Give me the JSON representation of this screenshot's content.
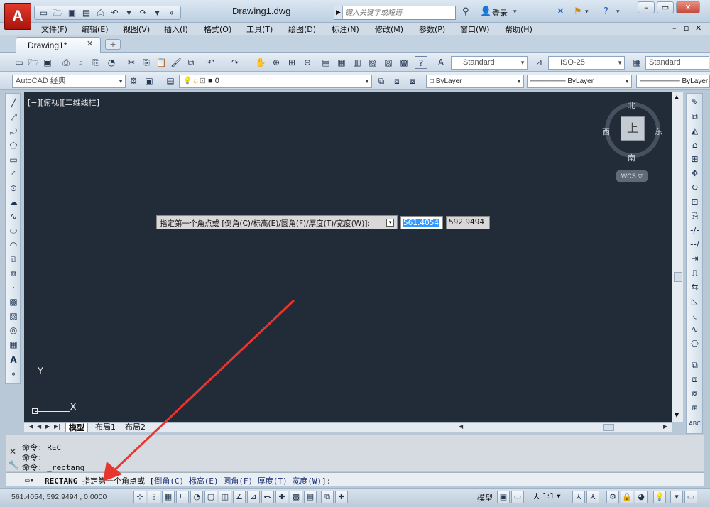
{
  "app": {
    "logo_letter": "A",
    "doc_title": "Drawing1.dwg"
  },
  "search": {
    "placeholder": "键入关键字或短语"
  },
  "user": {
    "login_label": "登录"
  },
  "menu": [
    "文件(F)",
    "编辑(E)",
    "视图(V)",
    "插入(I)",
    "格式(O)",
    "工具(T)",
    "绘图(D)",
    "标注(N)",
    "修改(M)",
    "参数(P)",
    "窗口(W)",
    "帮助(H)"
  ],
  "tabs": {
    "doc_tab": "Drawing1*"
  },
  "toolbar": {
    "text_style": "Standard",
    "dim_style": "ISO-25",
    "table_style": "Standard",
    "workspace": "AutoCAD 经典",
    "layer": "0",
    "color": "ByLayer",
    "linetype": "ByLayer",
    "lineweight": "ByLayer"
  },
  "viewport": {
    "label": "[−][俯视][二维线框]",
    "viewcube": {
      "face": "上",
      "north": "北",
      "south": "南",
      "east": "东",
      "west": "西",
      "wcs": "WCS"
    },
    "ucs": {
      "x": "X",
      "y": "Y"
    }
  },
  "dynamic_input": {
    "prompt": "指定第一个角点或 [倒角(C)/标高(E)/圆角(F)/厚度(T)/宽度(W)]:",
    "x_value": "561.4054",
    "y_value": "592.9494"
  },
  "layout_tabs": [
    "模型",
    "布局1",
    "布局2"
  ],
  "command_history": [
    "命令: REC",
    "命令:",
    "命令: _rectang"
  ],
  "command_line": {
    "command": "RECTANG",
    "prompt": "指定第一个角点或",
    "options": [
      "倒角(C)",
      "标高(E)",
      "圆角(F)",
      "厚度(T)",
      "宽度(W)"
    ],
    "suffix": ":"
  },
  "status": {
    "coords": "561.4054,  592.9494 , 0.0000",
    "model": "模型",
    "scale": "1:1"
  }
}
